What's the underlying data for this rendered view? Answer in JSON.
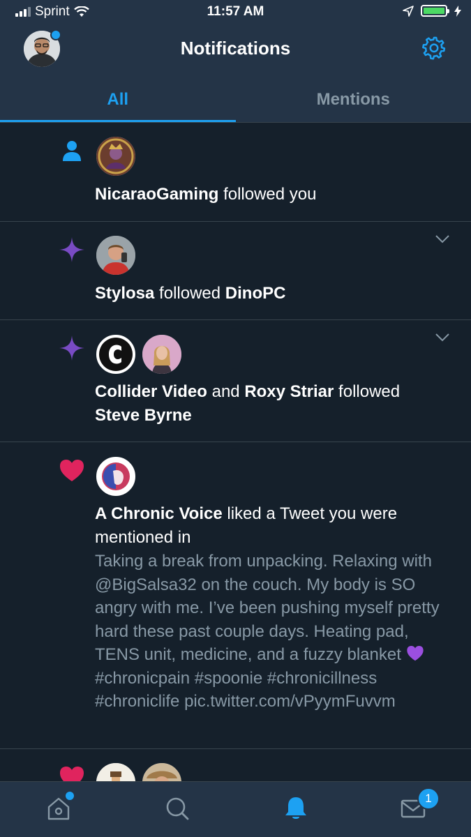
{
  "status_bar": {
    "carrier": "Sprint",
    "time": "11:57 AM"
  },
  "header": {
    "title": "Notifications"
  },
  "tabs": [
    {
      "label": "All",
      "active": true
    },
    {
      "label": "Mentions",
      "active": false
    }
  ],
  "notifications": [
    {
      "type": "follow",
      "icon": "person-icon",
      "actor": "NicaraoGaming",
      "action": "followed you"
    },
    {
      "type": "recommendation",
      "icon": "sparkle-icon",
      "actor": "Stylosa",
      "action": "followed",
      "target": "DinoPC"
    },
    {
      "type": "recommendation",
      "icon": "sparkle-icon",
      "actor": "Collider Video",
      "joiner": "and",
      "actor2": "Roxy Striar",
      "action": "followed",
      "target": "Steve Byrne"
    },
    {
      "type": "like",
      "icon": "heart-icon",
      "actor": "A Chronic Voice",
      "action": "liked a Tweet you were mentioned in",
      "tweet": {
        "part1": "Taking a break from unpacking. Relaxing with @BigSalsa32 on the couch. My body is SO angry with me. I’ve been pushing myself pretty hard these past couple days. Heating pad, TENS unit, medicine, and a fuzzy blanket",
        "emoji": "purple-heart-emoji",
        "part2": "#chronicpain #spoonie #chronicillness #chroniclife pic.twitter.com/vPyymFuvvm"
      }
    },
    {
      "type": "like",
      "icon": "heart-icon"
    }
  ],
  "tabbar": {
    "messages_badge": "1"
  },
  "colors": {
    "background": "#15202b",
    "bar": "#243447",
    "accent": "#1da1f2",
    "muted": "#8899a6",
    "divider": "#38444d",
    "heart": "#e0245e",
    "sparkle": "#794bc4"
  }
}
